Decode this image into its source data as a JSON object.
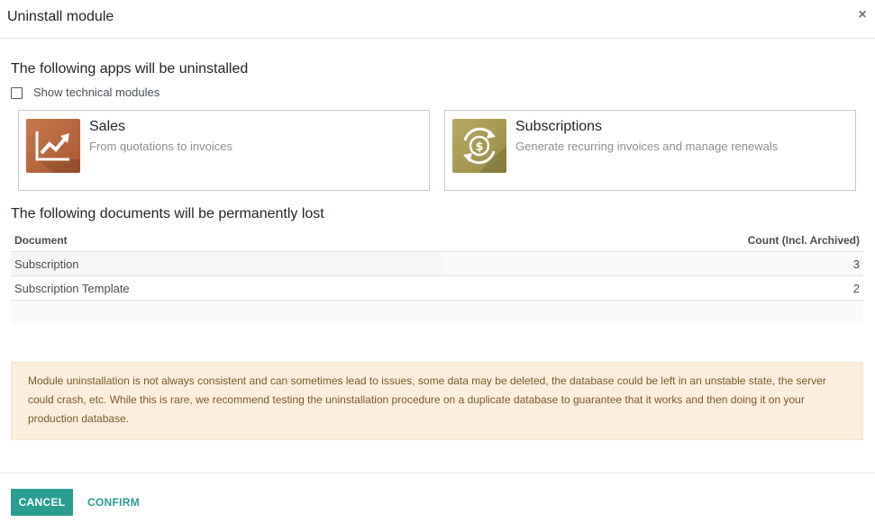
{
  "dialog": {
    "title": "Uninstall module",
    "close_glyph": "×"
  },
  "apps_section": {
    "title": "The following apps will be uninstalled",
    "show_technical_label": "Show technical modules",
    "show_technical_checked": false,
    "apps": [
      {
        "name": "Sales",
        "description": "From quotations to invoices",
        "icon": "sales-chart-icon",
        "color": "#b9683f"
      },
      {
        "name": "Subscriptions",
        "description": "Generate recurring invoices and manage renewals",
        "icon": "subscription-dollar-icon",
        "color": "#a69a51"
      }
    ]
  },
  "documents_section": {
    "title": "The following documents will be permanently lost",
    "columns": [
      "Document",
      "Count (Incl. Archived)"
    ],
    "rows": [
      {
        "document": "Subscription",
        "count": "3"
      },
      {
        "document": "Subscription Template",
        "count": "2"
      }
    ]
  },
  "warning": {
    "text": "Module uninstallation is not always consistent and can sometimes lead to issues, some data may be deleted, the database could be left in an unstable state, the server could crash, etc. While this is rare, we recommend testing the uninstallation procedure on a duplicate database to guarantee that it works and then doing it on your production database."
  },
  "footer": {
    "cancel_label": "CANCEL",
    "confirm_label": "CONFIRM",
    "accent_color": "#2a9d91"
  }
}
